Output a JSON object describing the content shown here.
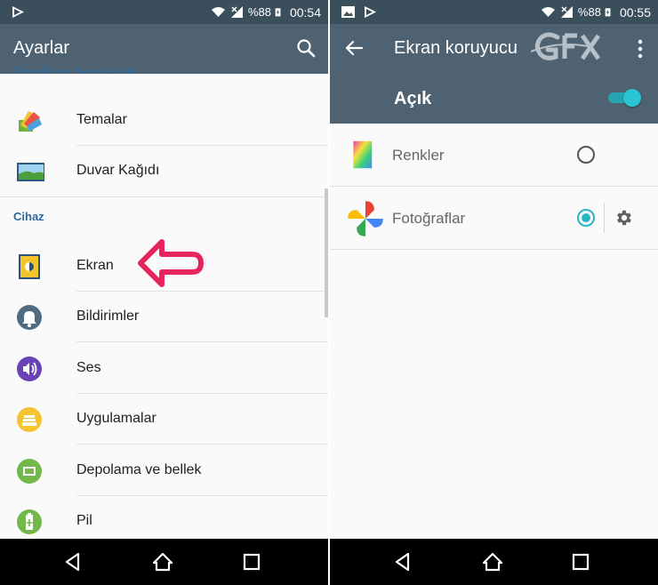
{
  "left": {
    "status": {
      "battery": "%88",
      "time": "00:54"
    },
    "appbar": {
      "title": "Ayarlar"
    },
    "cut_header": "Temalar ve duvar kağıdı",
    "items_top": [
      {
        "label": "Temalar",
        "icon": "themes-icon"
      },
      {
        "label": "Duvar Kağıdı",
        "icon": "wallpaper-icon"
      }
    ],
    "section_device": "Cihaz",
    "items_device": [
      {
        "label": "Ekran",
        "icon": "display-icon"
      },
      {
        "label": "Bildirimler",
        "icon": "bell-icon"
      },
      {
        "label": "Ses",
        "icon": "speaker-icon"
      },
      {
        "label": "Uygulamalar",
        "icon": "apps-icon"
      },
      {
        "label": "Depolama ve bellek",
        "icon": "storage-icon"
      },
      {
        "label": "Pil",
        "icon": "battery-icon"
      }
    ],
    "annotation_color": "#e8245f"
  },
  "right": {
    "status": {
      "battery": "%88",
      "time": "00:55"
    },
    "appbar": {
      "title": "Ekran koruyucu"
    },
    "master_switch": {
      "label": "Açık",
      "on": true
    },
    "savers": [
      {
        "label": "Renkler",
        "selected": false,
        "icon": "colors-icon"
      },
      {
        "label": "Fotoğraflar",
        "selected": true,
        "icon": "photos-icon"
      }
    ],
    "watermark": "GFX"
  },
  "colors": {
    "statusbar": "#3b4e5c",
    "appbar": "#4f6271",
    "accent": "#26b5c4",
    "section": "#2b6aa0"
  }
}
